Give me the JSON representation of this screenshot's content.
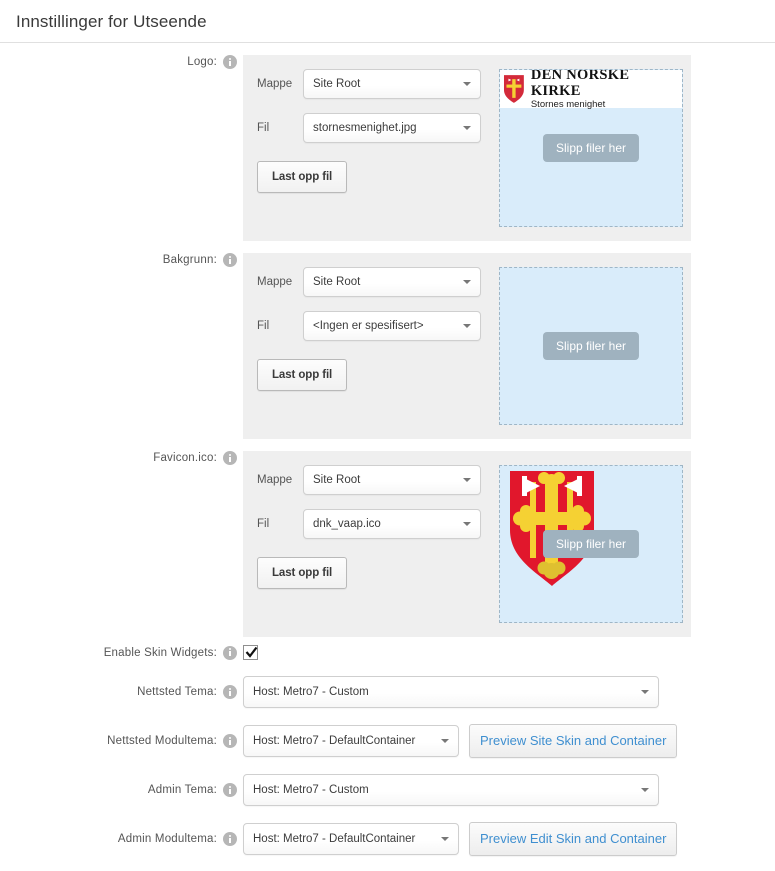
{
  "header": {
    "title": "Innstillinger for Utseende"
  },
  "common": {
    "folder_label": "Mappe",
    "file_label": "Fil",
    "upload_label": "Last opp fil",
    "drop_label": "Slipp filer her",
    "info_icon": "info-icon"
  },
  "sections": [
    {
      "label": "Logo:",
      "folder_value": "Site Root",
      "file_value": "stornesmenighet.jpg",
      "preview_kind": "logo",
      "logo": {
        "title": "DEN NORSKE KIRKE",
        "subtitle": "Stornes menighet"
      }
    },
    {
      "label": "Bakgrunn:",
      "folder_value": "Site Root",
      "file_value": "<Ingen er spesifisert>",
      "preview_kind": "none"
    },
    {
      "label": "Favicon.ico:",
      "folder_value": "Site Root",
      "file_value": "dnk_vaap.ico",
      "preview_kind": "favicon"
    }
  ],
  "settings": {
    "skin_widgets": {
      "label": "Enable Skin Widgets:",
      "checked": true
    },
    "site_theme": {
      "label": "Nettsted Tema:",
      "value": "Host: Metro7 - Custom"
    },
    "site_container": {
      "label": "Nettsted Modultema:",
      "value": "Host: Metro7 - DefaultContainer",
      "button": "Preview Site Skin and Container"
    },
    "admin_theme": {
      "label": "Admin Tema:",
      "value": "Host: Metro7 - Custom"
    },
    "admin_container": {
      "label": "Admin Modultema:",
      "value": "Host: Metro7 - DefaultContainer",
      "button": "Preview Edit Skin and Container"
    }
  },
  "colors": {
    "panel_bg": "#efefef",
    "dropzone_bg": "#d9ecfa",
    "dropzone_border": "#9fb6c6",
    "drop_button_bg": "#9fb2bf",
    "link_blue": "#3f8fd0",
    "shield_red": "#e1172c",
    "shield_gold": "#f5d133"
  }
}
